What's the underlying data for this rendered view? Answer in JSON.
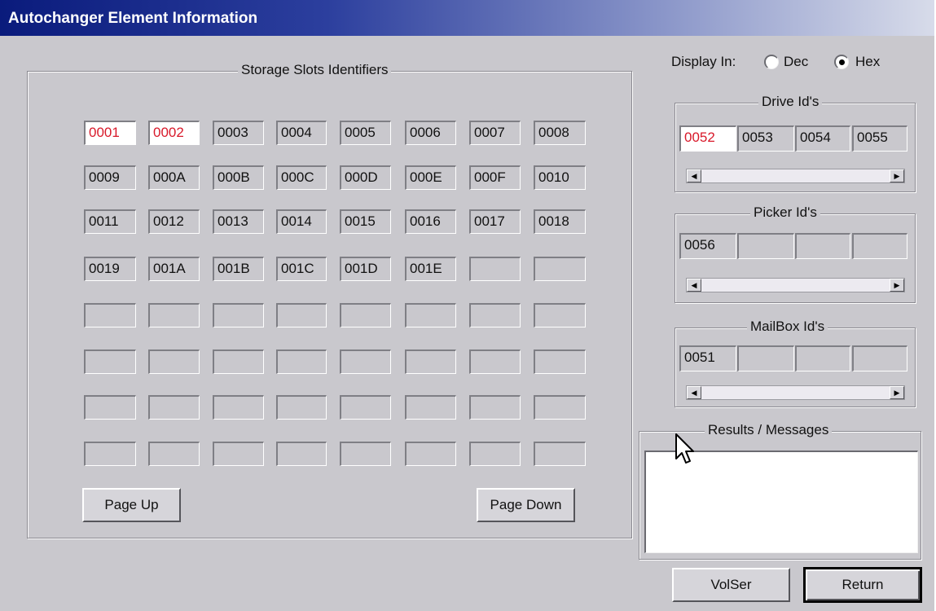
{
  "window": {
    "title": "Autochanger Element Information"
  },
  "storage": {
    "label": "Storage Slots Identifiers",
    "cells": [
      "0001",
      "0002",
      "0003",
      "0004",
      "0005",
      "0006",
      "0007",
      "0008",
      "0009",
      "000A",
      "000B",
      "000C",
      "000D",
      "000E",
      "000F",
      "0010",
      "0011",
      "0012",
      "0013",
      "0014",
      "0015",
      "0016",
      "0017",
      "0018",
      "0019",
      "001A",
      "001B",
      "001C",
      "001D",
      "001E",
      "",
      "",
      "",
      "",
      "",
      "",
      "",
      "",
      "",
      "",
      "",
      "",
      "",
      "",
      "",
      "",
      "",
      "",
      "",
      "",
      "",
      "",
      "",
      "",
      "",
      "",
      "",
      "",
      "",
      "",
      "",
      "",
      "",
      ""
    ],
    "selected": [
      "0001",
      "0002"
    ],
    "page_up": "Page Up",
    "page_down": "Page Down"
  },
  "display": {
    "label": "Display In:",
    "dec": "Dec",
    "hex": "Hex",
    "selected": "Hex"
  },
  "drives": {
    "label": "Drive Id's",
    "cells": [
      "0052",
      "0053",
      "0054",
      "0055"
    ],
    "selected": "0052"
  },
  "pickers": {
    "label": "Picker Id's",
    "cells": [
      "0056",
      "",
      "",
      ""
    ]
  },
  "mailbox": {
    "label": "MailBox Id's",
    "cells": [
      "0051",
      "",
      "",
      ""
    ]
  },
  "results": {
    "label": "Results / Messages",
    "text": ""
  },
  "buttons": {
    "volser": "VolSer",
    "return": "Return"
  },
  "colors": {
    "title_gradient_start": "#0a1b7c",
    "selected_text": "#d8192a",
    "background": "#c9c8cd"
  }
}
